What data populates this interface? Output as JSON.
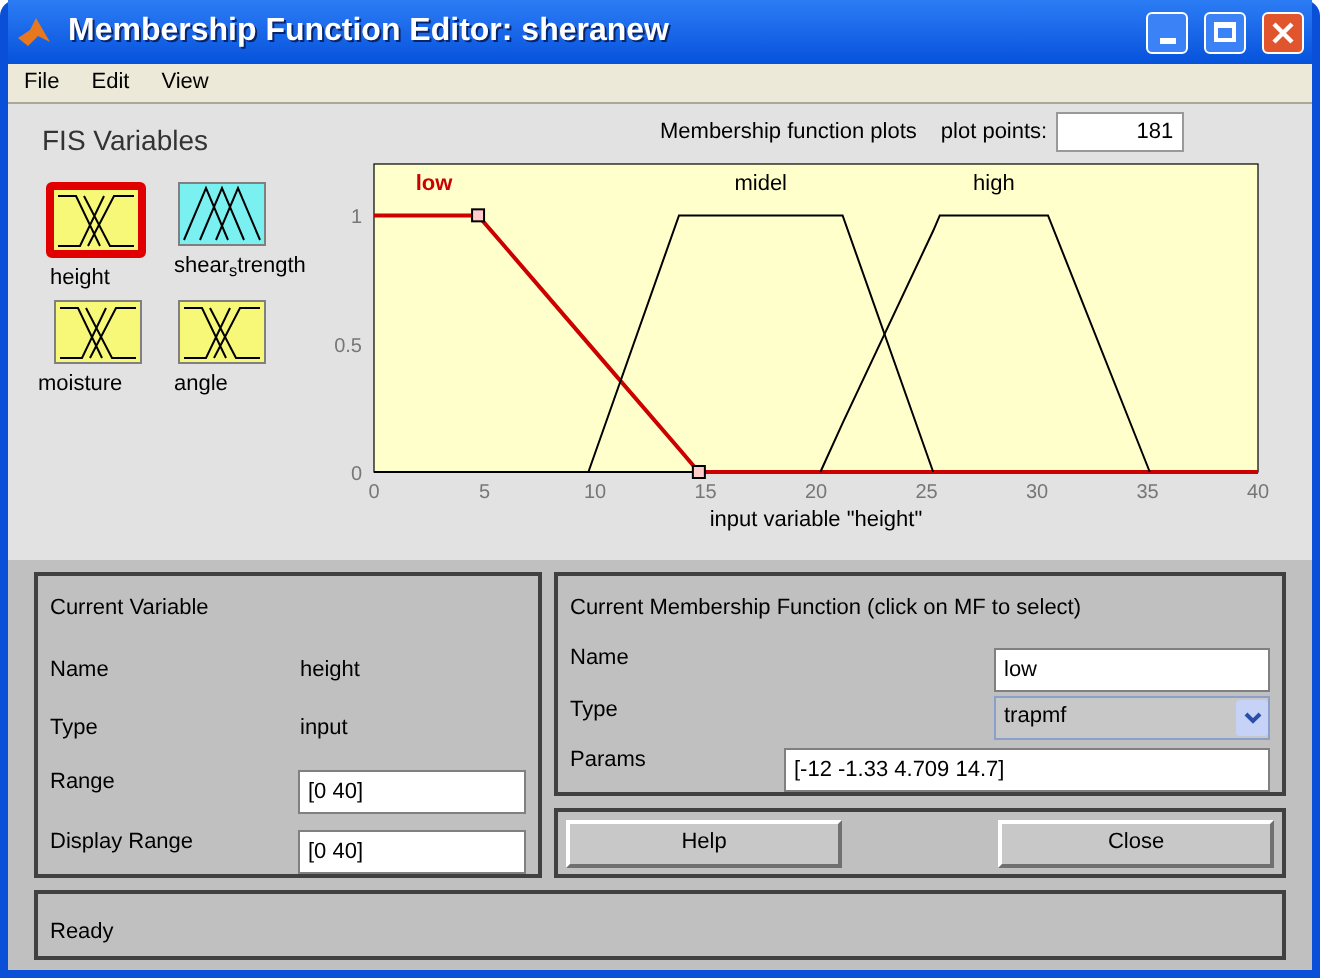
{
  "window": {
    "title": "Membership Function Editor: sheranew"
  },
  "menu": [
    "File",
    "Edit",
    "View"
  ],
  "fis_variables": {
    "title": "FIS Variables",
    "items": [
      {
        "name": "height",
        "kind": "input",
        "selected": true
      },
      {
        "name": "shear$_{s}$trength",
        "kind": "output",
        "selected": false
      },
      {
        "name": "moisture",
        "kind": "input",
        "selected": false
      },
      {
        "name": "angle",
        "kind": "input",
        "selected": false
      }
    ]
  },
  "plot": {
    "curves": [
      {
        "selected": true
      },
      {
        "selected": false
      },
      {
        "selected": false
      }
    ],
    "title": "Membership function plots",
    "plot_points_label": "plot points:",
    "plot_points": "181",
    "chart_data": {
      "type": "line",
      "xlabel": "input variable \"height\"",
      "x": [
        0,
        4.709,
        9.7,
        13.8,
        14.7,
        20.2,
        21.2,
        25.3,
        25.6,
        30.5,
        35.1,
        40
      ],
      "xlim": [
        0,
        40
      ],
      "ylim": [
        0,
        1.2
      ],
      "xticks": [
        0,
        5,
        10,
        15,
        20,
        25,
        30,
        35,
        40
      ],
      "yticks": [
        0,
        0.5,
        1
      ],
      "series": [
        {
          "name": "low",
          "color": "#cc0000",
          "values": [
            1,
            1,
            0.5,
            0.09,
            0,
            0,
            0,
            0,
            0,
            0,
            0,
            0
          ]
        },
        {
          "name": "midel",
          "color": "#000000",
          "values": [
            null,
            null,
            0,
            1,
            1,
            1,
            1,
            0,
            null,
            null,
            null,
            null
          ]
        },
        {
          "name": "high",
          "color": "#000000",
          "values": [
            null,
            null,
            null,
            null,
            null,
            0,
            0.19,
            0.94,
            1,
            1,
            0,
            null
          ]
        }
      ]
    }
  },
  "current_variable": {
    "title": "Current Variable",
    "name_label": "Name",
    "name": "height",
    "type_label": "Type",
    "type": "input",
    "range_label": "Range",
    "range": "[0 40]",
    "display_range_label": "Display Range",
    "display_range": "[0 40]"
  },
  "current_mf": {
    "title": "Current Membership Function (click on MF to select)",
    "name_label": "Name",
    "name": "low",
    "type_label": "Type",
    "type": "trapmf",
    "params_label": "Params",
    "params": "[-12 -1.33 4.709 14.7]"
  },
  "buttons": [
    "Help",
    "Close"
  ],
  "status_bar": "Ready"
}
